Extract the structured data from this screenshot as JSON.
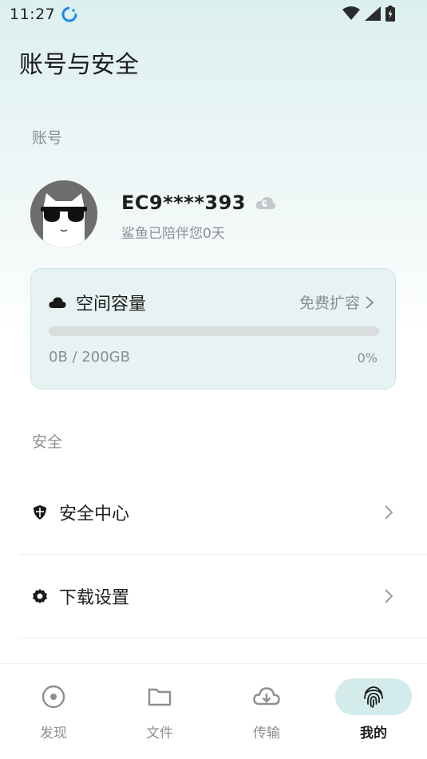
{
  "status_bar": {
    "time": "11:27"
  },
  "page": {
    "title": "账号与安全"
  },
  "account_section": {
    "label": "账号"
  },
  "user": {
    "name": "EC9****393",
    "subtitle": "鲨鱼已陪伴您0天"
  },
  "storage": {
    "title": "空间容量",
    "expand_label": "免费扩容",
    "usage_text": "0B / 200GB",
    "percent_text": "0%",
    "percent_value": 0
  },
  "security_section": {
    "label": "安全"
  },
  "menu": [
    {
      "label": "安全中心",
      "icon": "shield-icon"
    },
    {
      "label": "下载设置",
      "icon": "gear-icon"
    }
  ],
  "tabs": [
    {
      "label": "发现",
      "icon": "discover-icon",
      "active": false
    },
    {
      "label": "文件",
      "icon": "folder-icon",
      "active": false
    },
    {
      "label": "传输",
      "icon": "cloud-download-icon",
      "active": false
    },
    {
      "label": "我的",
      "icon": "fingerprint-icon",
      "active": true
    }
  ],
  "colors": {
    "accent": "#4aa9a1",
    "card_bg": "#e6f3f2",
    "active_tab_bg": "#d3eceb",
    "secondary_text": "#8a8f94"
  }
}
